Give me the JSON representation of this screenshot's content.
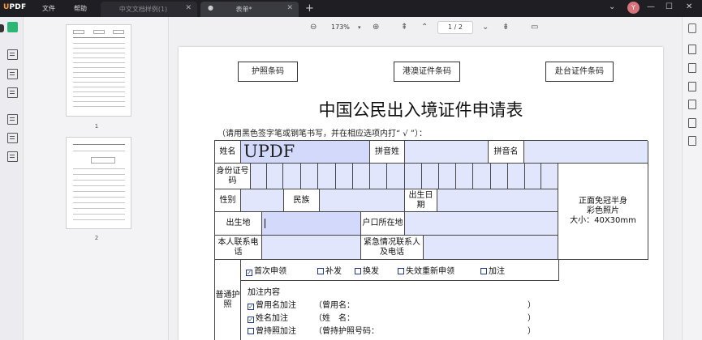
{
  "app": {
    "logo": "UPDF",
    "menu": [
      "文件",
      "帮助"
    ],
    "tabs": [
      {
        "label": "中文文档样例(1)",
        "active": false
      },
      {
        "label": "表单*",
        "active": true
      }
    ],
    "new_tab": "+",
    "avatar_letter": "Y"
  },
  "toolbar": {
    "zoom": "173%",
    "page": "1 / 2"
  },
  "thumbnails": {
    "pages": [
      "1",
      "2"
    ]
  },
  "document": {
    "barcodes": [
      "护照条码",
      "港澳证件条码",
      "赴台证件条码"
    ],
    "title": "中国公民出入境证件申请表",
    "instruction": "（请用黑色签字笔或钢笔书写，并在相应选项内打“ √ ”）：",
    "labels": {
      "name": "姓名",
      "name_value": "UPDF",
      "pinyin_surname": "拼音姓",
      "pinyin_given": "拼音名",
      "id_number": "身份证号码",
      "gender": "性别",
      "ethnicity": "民族",
      "birth_date": "出生日期",
      "birthplace": "出生地",
      "household": "户口所在地",
      "contact": "本人联系电话",
      "emergency": "紧急情况联系人及电话",
      "photo_line1": "正面免冠半身",
      "photo_line2": "彩色照片",
      "photo_size_label": "大小：",
      "photo_size": "40X30mm",
      "passport_type": "普通护照"
    },
    "apply_options": [
      "首次申领",
      "补发",
      "换发",
      "失效重新申领",
      "加注"
    ],
    "apply_checked": [
      true,
      false,
      false,
      false,
      false
    ],
    "endorse": {
      "title": "加注内容",
      "rows": [
        {
          "label": "曾用名加注",
          "detail": "（曾用名：",
          "close": "）",
          "checked": true
        },
        {
          "label": "姓名加注",
          "detail": "（姓　名：",
          "close": "）",
          "checked": true
        },
        {
          "label": "曾持照加注",
          "detail": "（曾持护照号码：",
          "close": "）",
          "checked": false
        }
      ]
    }
  }
}
